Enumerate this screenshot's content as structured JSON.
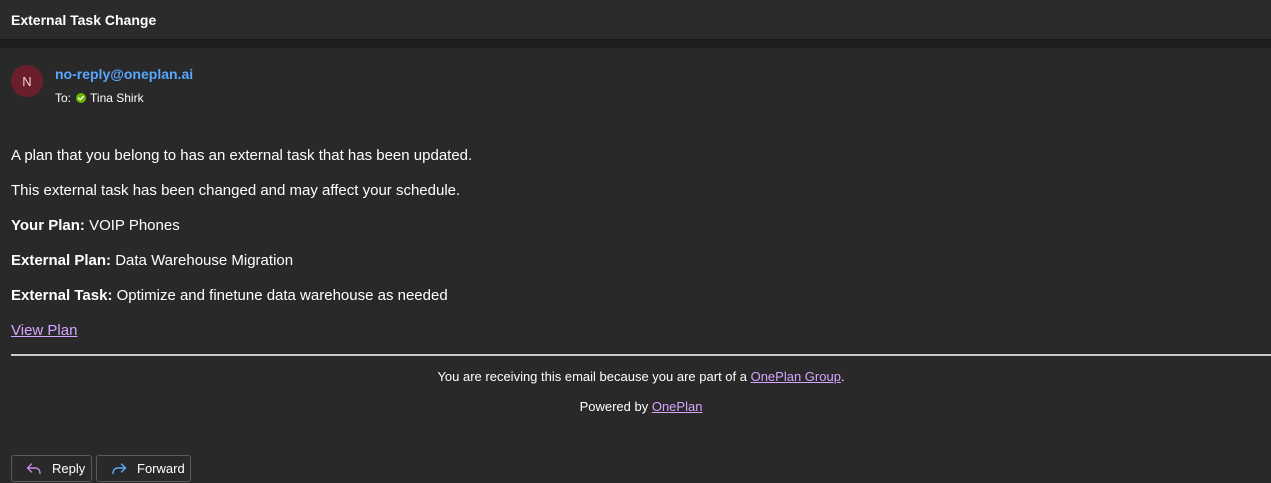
{
  "email": {
    "subject": "External Task Change",
    "sender": {
      "initial": "N",
      "address": "no-reply@oneplan.ai",
      "avatar_color": "#6b1e2b"
    },
    "recipients": {
      "label": "To:",
      "name": "Tina Shirk",
      "status_icon": "available-check-icon",
      "status_color": "#6bb700"
    },
    "body": {
      "intro": "A plan that you belong to has an external task that has been updated.",
      "notice": "This external task has been changed and may affect your schedule.",
      "your_plan": {
        "label": "Your Plan:",
        "value": "VOIP Phones"
      },
      "external_plan": {
        "label": "External Plan:",
        "value": "Data Warehouse Migration"
      },
      "external_task": {
        "label": "External Task:",
        "value": "Optimize and finetune data warehouse as needed"
      },
      "view_plan_link": "View Plan"
    },
    "footer": {
      "receiving_text": "You are receiving this email because you are part of a ",
      "group_link": "OnePlan Group",
      "period": ".",
      "powered_by": "Powered by ",
      "powered_link": "OnePlan"
    }
  },
  "actions": {
    "reply": {
      "label": "Reply",
      "icon": "reply-arrow-icon"
    },
    "forward": {
      "label": "Forward",
      "icon": "forward-arrow-icon"
    }
  },
  "colors": {
    "background": "#292929",
    "link": "#d7a4ff",
    "sender": "#58a6ff"
  }
}
